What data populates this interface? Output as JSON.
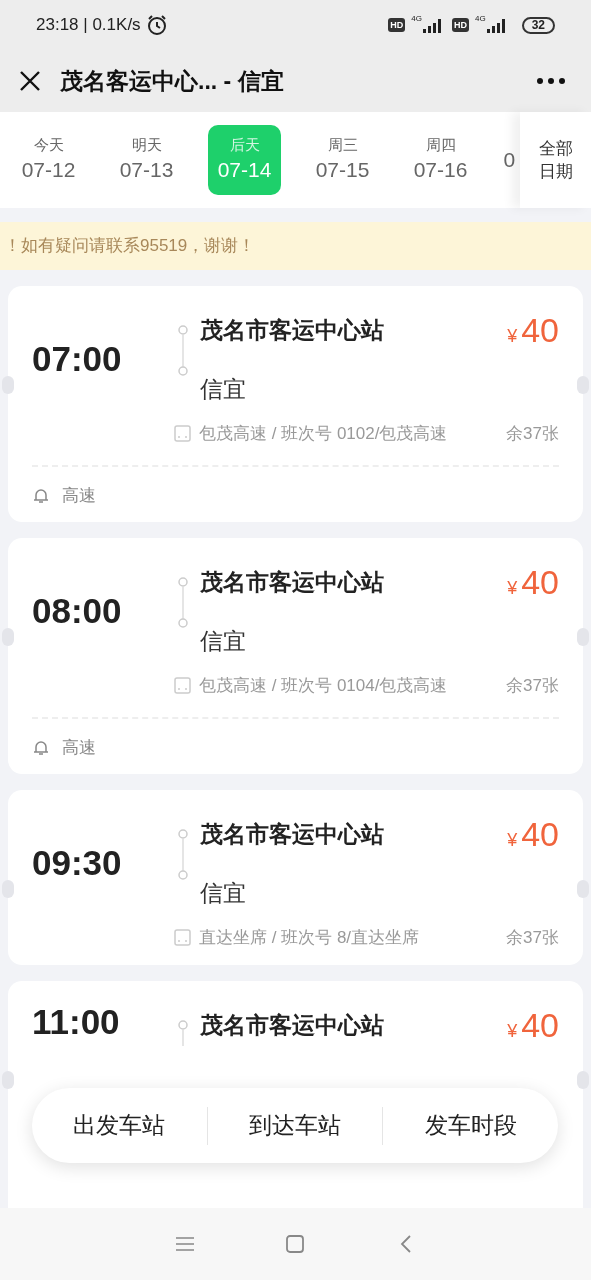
{
  "status_bar": {
    "time": "23:18 | 0.1K/s",
    "hd_1": "HD",
    "net_1": "4G",
    "hd_2": "HD",
    "net_2": "4G",
    "battery": "32"
  },
  "header": {
    "title": "茂名客运中心... - 信宜"
  },
  "dates": [
    {
      "day": "今天",
      "date": "07-12",
      "selected": false
    },
    {
      "day": "明天",
      "date": "07-13",
      "selected": false
    },
    {
      "day": "后天",
      "date": "07-14",
      "selected": true
    },
    {
      "day": "周三",
      "date": "07-15",
      "selected": false
    },
    {
      "day": "周四",
      "date": "07-16",
      "selected": false
    },
    {
      "date": "0",
      "selected": false
    }
  ],
  "all_dates": {
    "line_1": "全部",
    "line_2": "日期"
  },
  "notice": "！如有疑问请联系95519，谢谢！",
  "trips": [
    {
      "time": "07:00",
      "origin": "茂名市客运中心站",
      "destination": "信宜",
      "currency": "¥",
      "price": "40",
      "info": "包茂高速 / 班次号 0102/包茂高速",
      "seats": "余37张",
      "note": "高速"
    },
    {
      "time": "08:00",
      "origin": "茂名市客运中心站",
      "destination": "信宜",
      "currency": "¥",
      "price": "40",
      "info": "包茂高速 / 班次号 0104/包茂高速",
      "seats": "余37张",
      "note": "高速"
    },
    {
      "time": "09:30",
      "origin": "茂名市客运中心站",
      "destination": "信宜",
      "currency": "¥",
      "price": "40",
      "info": "直达坐席 / 班次号 8/直达坐席",
      "seats": "余37张"
    },
    {
      "time": "11:00",
      "origin": "茂名市客运中心站",
      "currency": "¥",
      "price": "40"
    }
  ],
  "filter_bar": [
    "出发车站",
    "到达车站",
    "发车时段"
  ]
}
